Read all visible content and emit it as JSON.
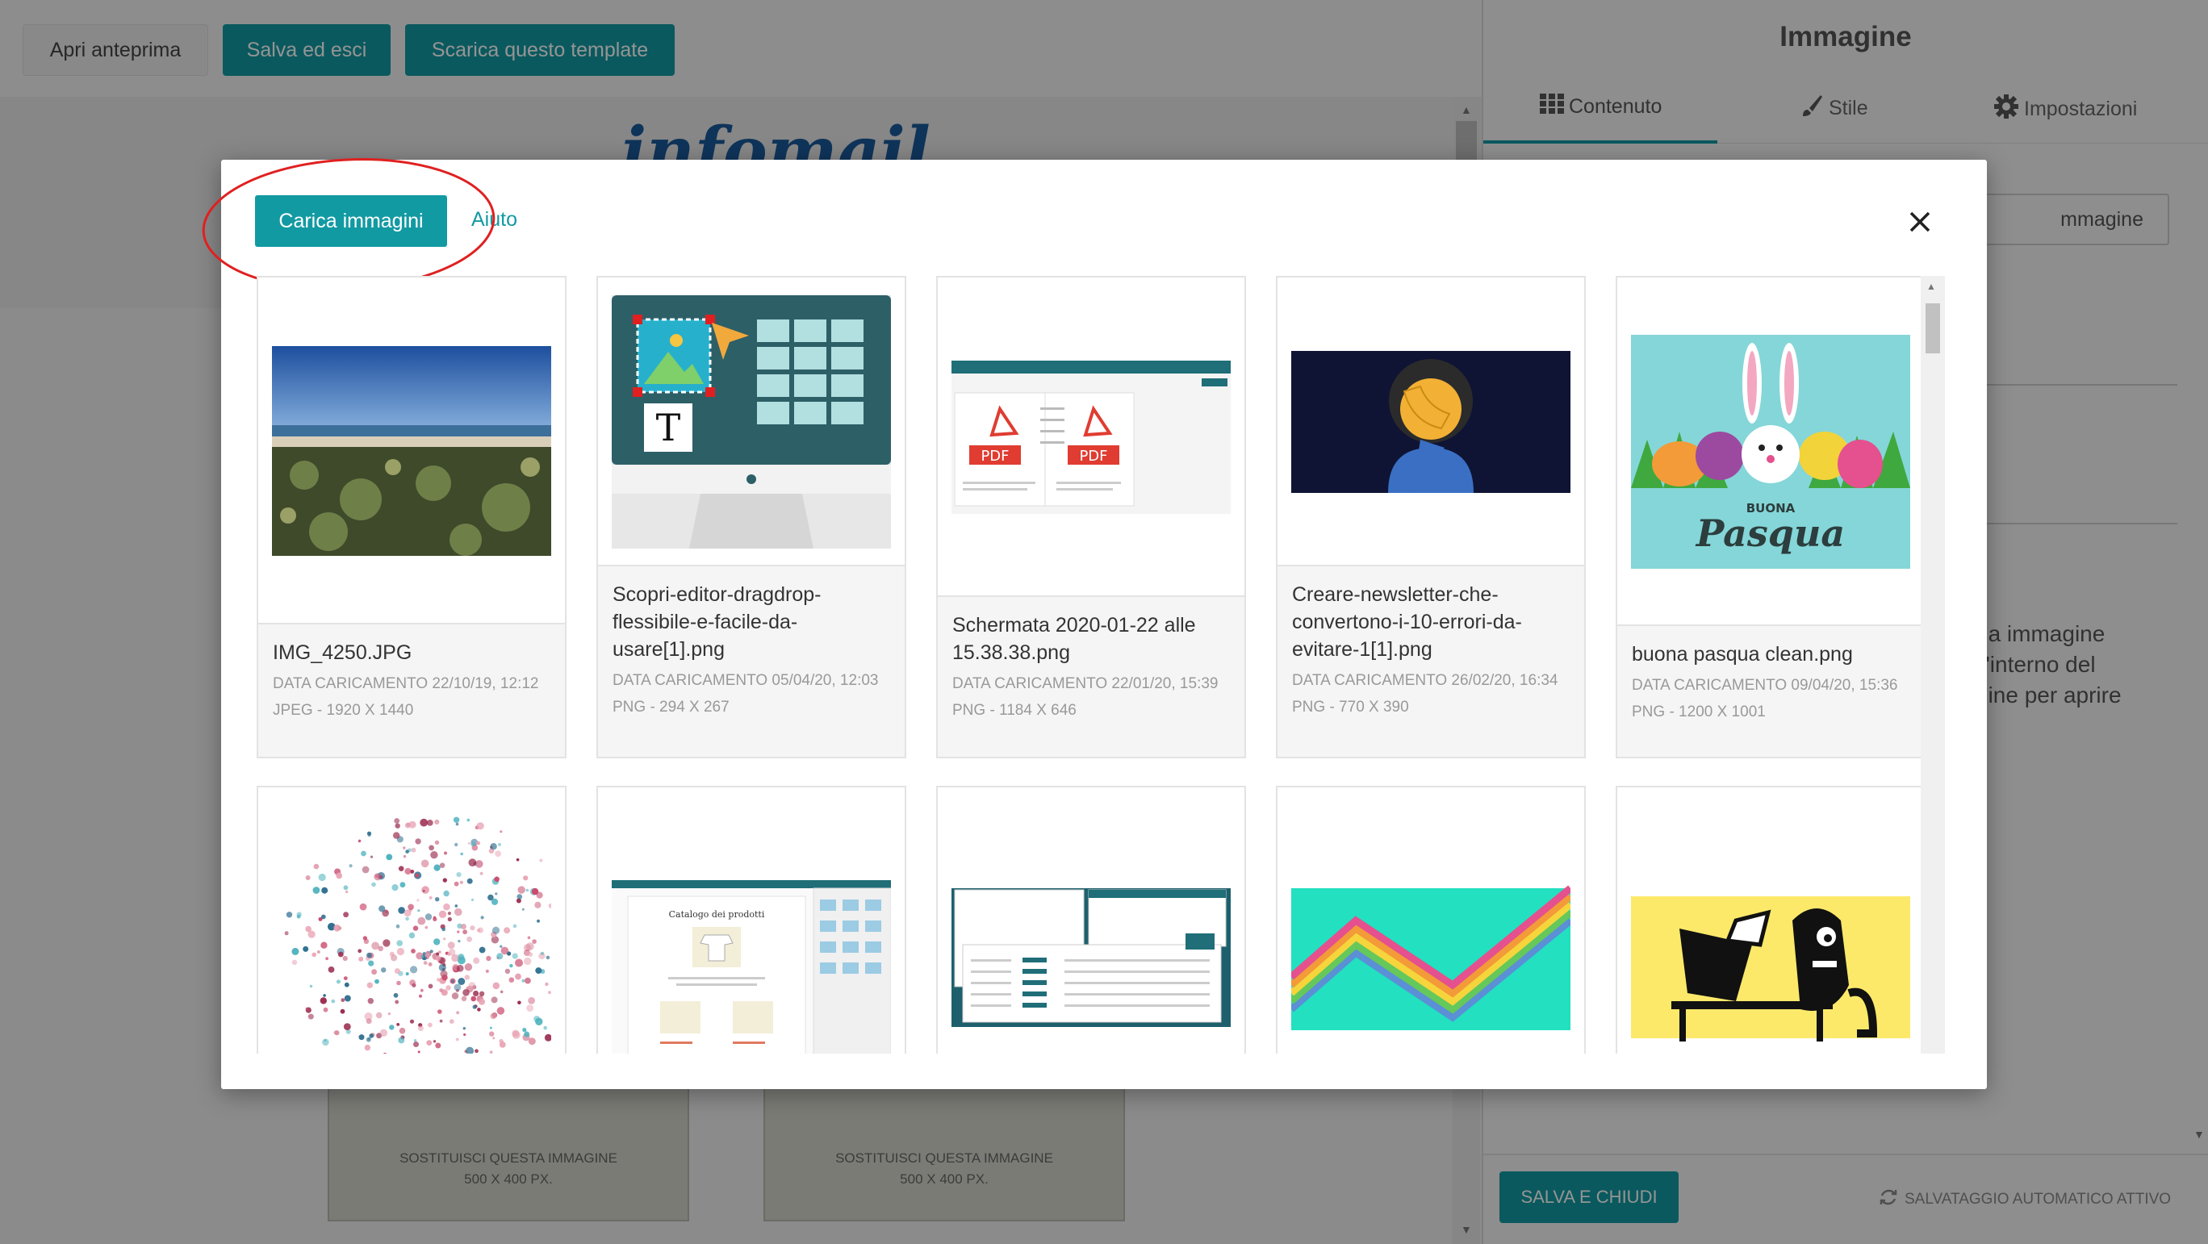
{
  "toolbar": {
    "preview_label": "Apri anteprima",
    "save_exit_label": "Salva ed esci",
    "download_label": "Scarica questo template"
  },
  "canvas": {
    "logo_text": "infomail",
    "placeholder_line1": "SOSTITUISCI QUESTA IMMAGINE",
    "placeholder_line2": "500 X 400 PX."
  },
  "right_panel": {
    "title": "Immagine",
    "tabs": [
      {
        "label": "Contenuto",
        "icon": "grid-icon",
        "active": true
      },
      {
        "label": "Stile",
        "icon": "brush-icon",
        "active": false
      },
      {
        "label": "Impostazioni",
        "icon": "gear-icon",
        "active": false
      }
    ],
    "image_button_partial": "mmagine",
    "help_text_lines": [
      "na immagine",
      "ll'interno del",
      "gine per aprire"
    ],
    "save_close_label": "SALVA E CHIUDI",
    "autosave_label": "SALVATAGGIO AUTOMATICO ATTIVO"
  },
  "modal": {
    "upload_label": "Carica immagini",
    "help_label": "Aiuto",
    "close_icon": "close-icon",
    "annotation_color": "#e02020",
    "images": [
      {
        "name": "IMG_4250.JPG",
        "date": "DATA CARICAMENTO 22/10/19, 12:12",
        "meta": "JPEG - 1920 X 1440"
      },
      {
        "name": "Scopri-editor-dragdrop-flessibile-e-facile-da-usare[1].png",
        "date": "DATA CARICAMENTO 05/04/20, 12:03",
        "meta": "PNG - 294 X 267"
      },
      {
        "name": "Schermata 2020-01-22 alle 15.38.38.png",
        "date": "DATA CARICAMENTO 22/01/20, 15:39",
        "meta": "PNG - 1184 X 646"
      },
      {
        "name": "Creare-newsletter-che-convertono-i-10-errori-da-evitare-1[1].png",
        "date": "DATA CARICAMENTO 26/02/20, 16:34",
        "meta": "PNG - 770 X 390"
      },
      {
        "name": "buona pasqua clean.png",
        "date": "DATA CARICAMENTO 09/04/20, 15:36",
        "meta": "PNG - 1200 X 1001"
      }
    ],
    "thumb_text": {
      "pdf": "PDF",
      "buona": "BUONA",
      "pasqua": "Pasqua",
      "catalog": "Catalogo dei prodotti",
      "t_letter": "T"
    }
  },
  "colors": {
    "accent": "#129aa3",
    "overlay": "rgba(0,0,0,0.42)"
  }
}
